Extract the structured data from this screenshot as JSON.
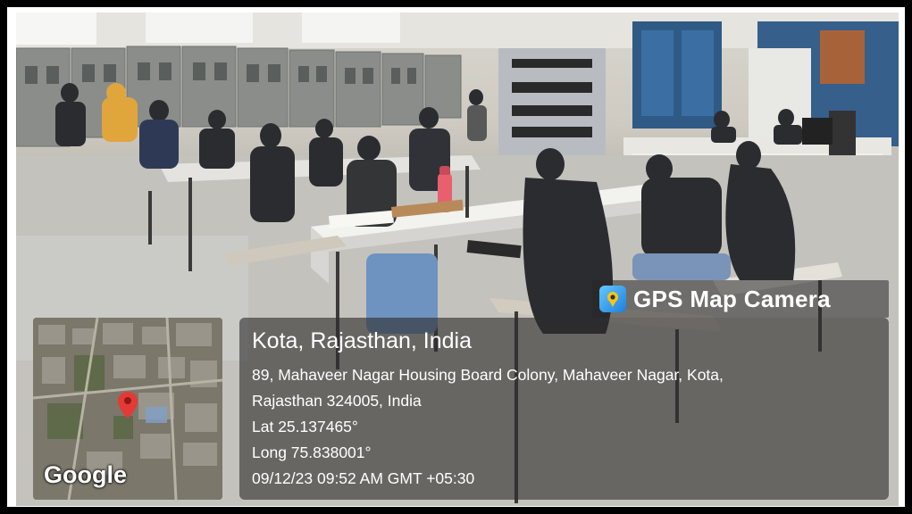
{
  "overlay": {
    "app_name": "GPS Map Camera",
    "app_icon": "gps-map-camera-icon",
    "location_title": "Kota, Rajasthan, India",
    "address_line_1": "89, Mahaveer Nagar Housing Board Colony, Mahaveer Nagar, Kota,",
    "address_line_2": "Rajasthan 324005, India",
    "latitude": "Lat 25.137465°",
    "longitude": "Long 75.838001°",
    "timestamp": "09/12/23 09:52 AM GMT +05:30"
  },
  "map": {
    "attribution": "Google",
    "pin_icon": "location-pin-icon",
    "pin_color": "#e53935"
  },
  "colors": {
    "overlay_bg": "rgba(45,45,45,0.62)",
    "text": "#ffffff",
    "bottle": "#e8606e"
  }
}
